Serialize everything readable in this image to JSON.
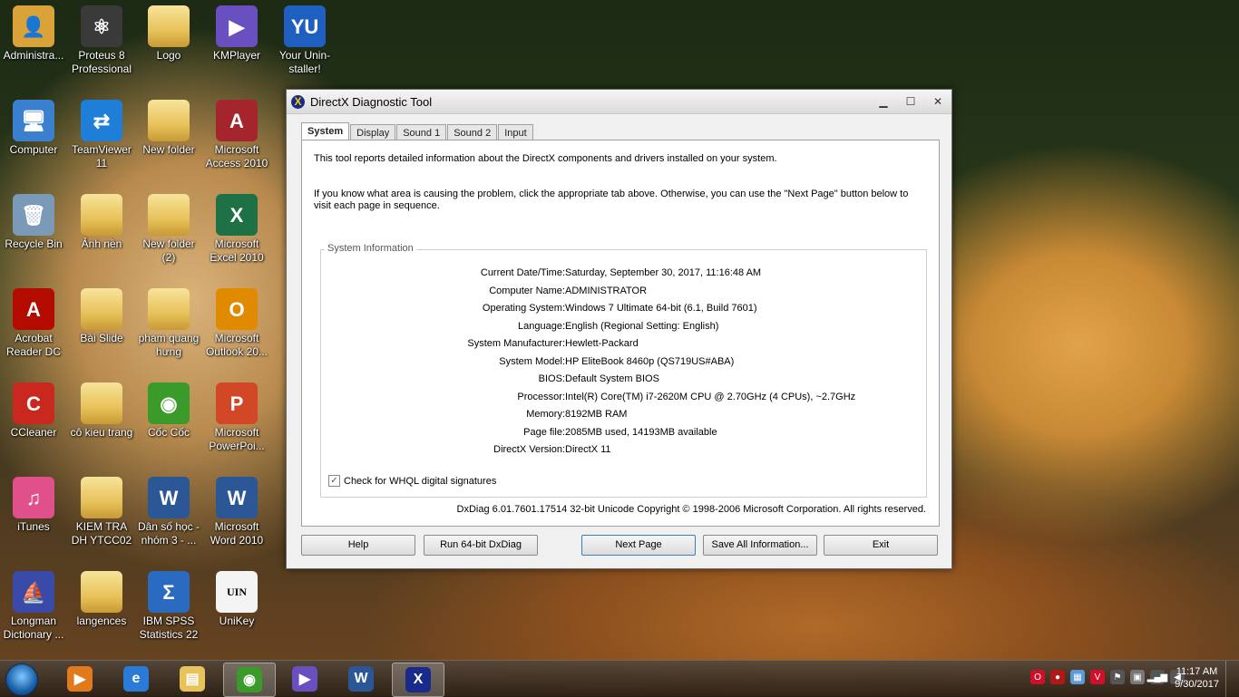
{
  "desktop": {
    "icons": [
      {
        "label": "Administra...",
        "glyph": "👤",
        "color": "#d9a33a"
      },
      {
        "label": "Proteus 8 Professional",
        "glyph": "⚛",
        "color": "#3a3a3a"
      },
      {
        "label": "Logo",
        "glyph": "",
        "color": "folder"
      },
      {
        "label": "KMPlayer",
        "glyph": "▶",
        "color": "#6a4fc0"
      },
      {
        "label": "Your Unin-staller!",
        "glyph": "YU",
        "color": "#1f5fbf"
      },
      {
        "label": "Computer",
        "glyph": "🖥",
        "color": "#3b7fcf"
      },
      {
        "label": "TeamViewer 11",
        "glyph": "⇄",
        "color": "#1f7fd8"
      },
      {
        "label": "New folder",
        "glyph": "",
        "color": "folder"
      },
      {
        "label": "Microsoft Access 2010",
        "glyph": "A",
        "color": "#a4262c"
      },
      {
        "label": "Recycle Bin",
        "glyph": "🗑",
        "color": "#7a9ab8"
      },
      {
        "label": "Ảnh nền",
        "glyph": "",
        "color": "folder"
      },
      {
        "label": "New folder (2)",
        "glyph": "",
        "color": "folder"
      },
      {
        "label": "Microsoft Excel 2010",
        "glyph": "X",
        "color": "#1e7145"
      },
      {
        "label": "Acrobat Reader DC",
        "glyph": "A",
        "color": "#b30b00"
      },
      {
        "label": "Bài Slide",
        "glyph": "",
        "color": "folder"
      },
      {
        "label": "pham quang hưng",
        "glyph": "",
        "color": "folder"
      },
      {
        "label": "Microsoft Outlook 20...",
        "glyph": "O",
        "color": "#e08a00"
      },
      {
        "label": "CCleaner",
        "glyph": "C",
        "color": "#c8281e"
      },
      {
        "label": "cô kieu trang",
        "glyph": "",
        "color": "folder"
      },
      {
        "label": "Cốc Cốc",
        "glyph": "◉",
        "color": "#3a9a2a"
      },
      {
        "label": "Microsoft PowerPoi...",
        "glyph": "P",
        "color": "#d24726"
      },
      {
        "label": "iTunes",
        "glyph": "♫",
        "color": "#e0508a"
      },
      {
        "label": "KIEM TRA DH YTCC02",
        "glyph": "",
        "color": "folder"
      },
      {
        "label": "Dân số học - nhóm 3 - ...",
        "glyph": "W",
        "color": "#2b5797"
      },
      {
        "label": "Microsoft Word 2010",
        "glyph": "W",
        "color": "#2b5797"
      },
      {
        "label": "Longman Dictionary ...",
        "glyph": "⛵",
        "color": "#3a4aa8"
      },
      {
        "label": "langences",
        "glyph": "",
        "color": "folder"
      },
      {
        "label": "IBM SPSS Statistics 22",
        "glyph": "Σ",
        "color": "#2a6ac0"
      },
      {
        "label": "UniKey",
        "glyph": "UIN",
        "color": "#f4f4f4"
      }
    ]
  },
  "window": {
    "title": "DirectX Diagnostic Tool",
    "title_icon": "X",
    "minimize": "▁",
    "maximize": "☐",
    "close": "✕",
    "tabs": [
      "System",
      "Display",
      "Sound 1",
      "Sound 2",
      "Input"
    ],
    "intro1": "This tool reports detailed information about the DirectX components and drivers installed on your system.",
    "intro2": "If you know what area is causing the problem, click the appropriate tab above.  Otherwise, you can use the \"Next Page\" button below to visit each page in sequence.",
    "group_label": "System Information",
    "info": [
      {
        "k": "Current Date/Time:",
        "v": "Saturday, September 30, 2017, 11:16:48 AM"
      },
      {
        "k": "Computer Name:",
        "v": "ADMINISTRATOR"
      },
      {
        "k": "Operating System:",
        "v": "Windows 7 Ultimate 64-bit (6.1, Build 7601)"
      },
      {
        "k": "Language:",
        "v": "English (Regional Setting: English)"
      },
      {
        "k": "System Manufacturer:",
        "v": "Hewlett-Packard"
      },
      {
        "k": "System Model:",
        "v": "HP EliteBook 8460p (QS719US#ABA)"
      },
      {
        "k": "BIOS:",
        "v": "Default System BIOS"
      },
      {
        "k": "Processor:",
        "v": "Intel(R) Core(TM) i7-2620M CPU @ 2.70GHz (4 CPUs), ~2.7GHz"
      },
      {
        "k": "Memory:",
        "v": "8192MB RAM"
      },
      {
        "k": "Page file:",
        "v": "2085MB used, 14193MB available"
      },
      {
        "k": "DirectX Version:",
        "v": "DirectX 11"
      }
    ],
    "whql_label": "Check for WHQL digital signatures",
    "whql_checked": "✓",
    "footer": "DxDiag 6.01.7601.17514 32-bit Unicode  Copyright © 1998-2006 Microsoft Corporation.  All rights reserved.",
    "buttons": {
      "help": "Help",
      "run64": "Run 64-bit DxDiag",
      "next": "Next Page",
      "save": "Save All Information...",
      "exit": "Exit"
    }
  },
  "taskbar": {
    "items": [
      {
        "name": "media-player",
        "glyph": "▶",
        "color": "#e07a1a"
      },
      {
        "name": "internet-explorer",
        "glyph": "e",
        "color": "#2a7ad8"
      },
      {
        "name": "file-explorer",
        "glyph": "▤",
        "color": "#e8c25a"
      },
      {
        "name": "coccoc-browser",
        "glyph": "◉",
        "color": "#3a9a2a"
      },
      {
        "name": "kmplayer",
        "glyph": "▶",
        "color": "#6a4fc0"
      },
      {
        "name": "word",
        "glyph": "W",
        "color": "#2b5797"
      },
      {
        "name": "dxdiag",
        "glyph": "X",
        "color": "#1a2a8a"
      }
    ],
    "tray": [
      {
        "name": "opera-tray",
        "glyph": "O",
        "color": "#d0102a"
      },
      {
        "name": "antivirus-tray",
        "glyph": "●",
        "color": "#b01818"
      },
      {
        "name": "network-tray",
        "glyph": "▦",
        "color": "#5a9ad8"
      },
      {
        "name": "unikey-tray",
        "glyph": "V",
        "color": "#d0102a"
      },
      {
        "name": "flag-tray",
        "glyph": "⚑",
        "color": "#555555"
      },
      {
        "name": "devices-tray",
        "glyph": "▣",
        "color": "#777777"
      },
      {
        "name": "signal-tray",
        "glyph": "▂▄▆",
        "color": "#555555"
      },
      {
        "name": "volume-tray",
        "glyph": "◀",
        "color": "#555555"
      }
    ],
    "time": "11:17 AM",
    "date": "9/30/2017"
  }
}
